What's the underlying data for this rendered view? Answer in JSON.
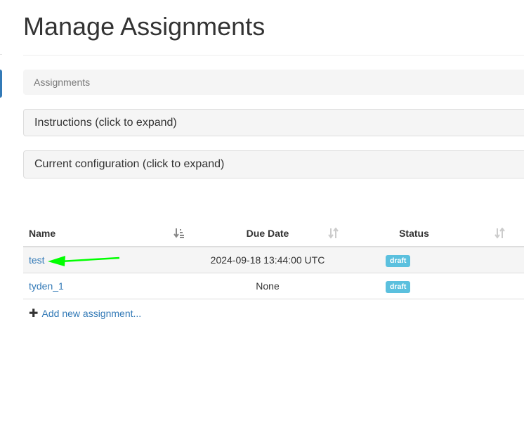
{
  "page": {
    "title": "Manage Assignments"
  },
  "breadcrumb": {
    "current": "Assignments"
  },
  "panels": {
    "instructions": "Instructions (click to expand)",
    "configuration": "Current configuration (click to expand)"
  },
  "table": {
    "headers": {
      "name": "Name",
      "due_date": "Due Date",
      "status": "Status"
    },
    "rows": [
      {
        "name": "test",
        "due_date": "2024-09-18 13:44:00 UTC",
        "status": "draft"
      },
      {
        "name": "tyden_1",
        "due_date": "None",
        "status": "draft"
      }
    ]
  },
  "add_link": {
    "label": "Add new assignment..."
  },
  "icons": {
    "name_sort": "sort-amount-asc-icon",
    "due_sort": "sort-icon",
    "status_sort": "sort-icon",
    "plus": "plus-icon",
    "arrow": "green-arrow-annotation"
  },
  "colors": {
    "link": "#337ab7",
    "draft_badge": "#5bc0de",
    "annotation_arrow": "#00ff00"
  }
}
